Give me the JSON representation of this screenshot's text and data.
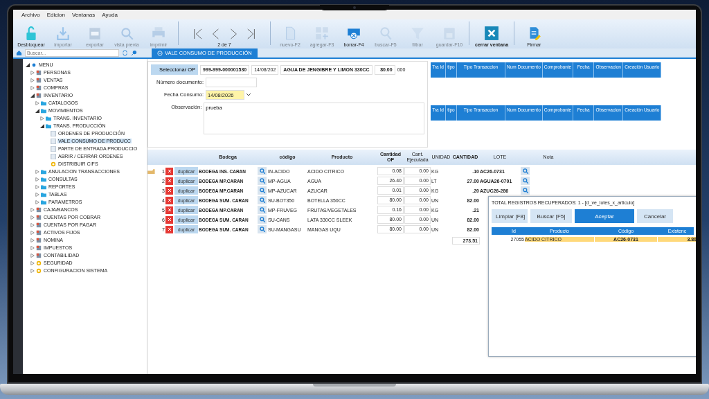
{
  "menu_bar": [
    "Archivo",
    "Edicion",
    "Ventanas",
    "Ayuda"
  ],
  "toolbar": [
    {
      "kind": "unlock",
      "label": "Desbloquear",
      "disabled": false
    },
    {
      "kind": "import",
      "label": "importar",
      "disabled": true
    },
    {
      "kind": "export",
      "label": "exportar",
      "disabled": true
    },
    {
      "kind": "preview",
      "label": "vista previa",
      "disabled": true
    },
    {
      "kind": "print",
      "label": "imprimir",
      "disabled": true
    },
    {
      "kind": "nav",
      "label": "2 de 7",
      "disabled": false
    },
    {
      "kind": "new",
      "label": "nuevo-F2",
      "disabled": true
    },
    {
      "kind": "add",
      "label": "agregar-F3",
      "disabled": true
    },
    {
      "kind": "delete",
      "label": "borrar-F4",
      "disabled": false
    },
    {
      "kind": "search",
      "label": "buscar-F5",
      "disabled": true
    },
    {
      "kind": "filter",
      "label": "filtrar",
      "disabled": true
    },
    {
      "kind": "save",
      "label": "guardar-F10",
      "disabled": true
    },
    {
      "kind": "close",
      "label": "cerrar ventana",
      "disabled": false
    },
    {
      "kind": "sign",
      "label": "Firmar",
      "disabled": false
    }
  ],
  "sidebar": {
    "search": {
      "placeholder": "Buscar..."
    },
    "tree": [
      {
        "label": "MENU",
        "kind": "root",
        "expanded": true,
        "selected": false,
        "children": [
          {
            "label": "PERSONAS",
            "kind": "module",
            "expanded": false,
            "selected": false
          },
          {
            "label": "VENTAS",
            "kind": "module",
            "expanded": false,
            "selected": false
          },
          {
            "label": "COMPRAS",
            "kind": "module",
            "expanded": false,
            "selected": false
          },
          {
            "label": "INVENTARIO",
            "kind": "module",
            "expanded": true,
            "selected": false,
            "children": [
              {
                "label": "CATALOGOS",
                "kind": "folder",
                "expanded": false,
                "selected": false
              },
              {
                "label": "MOVIMIENTOS",
                "kind": "folder",
                "expanded": true,
                "selected": false,
                "children": [
                  {
                    "label": "TRANS. INVENTARIO",
                    "kind": "folder",
                    "expanded": false,
                    "selected": false
                  },
                  {
                    "label": "TRANS. PRODUCCIÓN",
                    "kind": "folder",
                    "expanded": true,
                    "selected": false,
                    "children": [
                      {
                        "label": "ORDENES DE PRODUCCIÓN",
                        "kind": "document",
                        "selected": false
                      },
                      {
                        "label": "VALE CONSUMO DE PRODUCC",
                        "kind": "document",
                        "selected": true
                      },
                      {
                        "label": "PARTE DE ENTRADA PRODUCCIO",
                        "kind": "document",
                        "selected": false
                      },
                      {
                        "label": "ABRIR / CERRAR ORDENES",
                        "kind": "document",
                        "selected": false
                      },
                      {
                        "label": "DISTRIBUIR CIFS",
                        "kind": "process",
                        "selected": false
                      }
                    ]
                  }
                ]
              },
              {
                "label": "ANULACION TRANSACCIONES",
                "kind": "folder",
                "expanded": false,
                "selected": false
              },
              {
                "label": "CONSULTAS",
                "kind": "folder",
                "expanded": false,
                "selected": false
              },
              {
                "label": "REPORTES",
                "kind": "folder",
                "expanded": false,
                "selected": false
              },
              {
                "label": "TABLAS",
                "kind": "folder",
                "expanded": false,
                "selected": false
              },
              {
                "label": "PARAMETROS",
                "kind": "folder",
                "expanded": false,
                "selected": false
              }
            ]
          },
          {
            "label": "CAJA/BANCOS",
            "kind": "module",
            "expanded": false,
            "selected": false
          },
          {
            "label": "CUENTAS POR COBRAR",
            "kind": "module",
            "expanded": false,
            "selected": false
          },
          {
            "label": "CUENTAS POR PAGAR",
            "kind": "module",
            "expanded": false,
            "selected": false
          },
          {
            "label": "ACTIVOS FIJOS",
            "kind": "module",
            "expanded": false,
            "selected": false
          },
          {
            "label": "NOMINA",
            "kind": "module",
            "expanded": false,
            "selected": false
          },
          {
            "label": "IMPUESTOS",
            "kind": "module",
            "expanded": false,
            "selected": false
          },
          {
            "label": "CONTABILIDAD",
            "kind": "module",
            "expanded": false,
            "selected": false
          },
          {
            "label": "SEGURIDAD",
            "kind": "process",
            "expanded": false,
            "selected": false
          },
          {
            "label": "CONFIGURACION SISTEMA",
            "kind": "process",
            "expanded": false,
            "selected": false
          }
        ]
      }
    ]
  },
  "tabs": [
    {
      "label": "VALE CONSUMO DE PRODUCCIÓN",
      "selected": true
    }
  ],
  "form": {
    "select_button": "Seleccionar OP",
    "order": {
      "number": "999-999-000001530",
      "date": "14/08/202",
      "product": "AGUA DE JENGIBRE Y LIMON 330CC",
      "quantity": "80.00",
      "unit": "000"
    },
    "fields": [
      {
        "label": "Número documento:",
        "kind": "text"
      },
      {
        "label": "Fecha Consumo:",
        "value": "14/08/2026",
        "kind": "date"
      },
      {
        "label": "Observación:",
        "value": "prueba",
        "kind": "memo"
      }
    ]
  },
  "grids": [
    {
      "columns": [
        "Tra Id",
        "tipo",
        "Tipo Transaccion",
        "Num Documento",
        "Comprobante",
        "Fecha",
        "Observacion",
        "Creación Usuario"
      ]
    },
    {
      "columns": [
        "Tra Id",
        "tipo",
        "Tipo Transaccion",
        "Num Documento",
        "Comprobante",
        "Fecha",
        "Observacion",
        "Creación Usuario"
      ]
    }
  ],
  "detail": {
    "columns": [
      "Bodega",
      "código",
      "Producto",
      "Cantidad OP",
      "Cant. Ejecutada",
      "UNIDAD",
      "CANTIDAD",
      "LOTE",
      "Nota"
    ],
    "rows": [
      {
        "num": "1",
        "current": true,
        "action": "duplicar",
        "bodega": "BODEGA INS. CARAN",
        "codigo": "IN-ACIDO",
        "producto": "ACIDO CITRICO",
        "cantidad_op": "0.08",
        "ejecutada": "0.00",
        "unidad": "KG",
        "cantidad": ".10",
        "lote": "AC26-0731"
      },
      {
        "num": "2",
        "current": false,
        "action": "duplicar",
        "bodega": "BODEGA MP.CARAN",
        "codigo": "MP-AGUA",
        "producto": "AGUA",
        "cantidad_op": "26.40",
        "ejecutada": "0.00",
        "unidad": "LT",
        "cantidad": "27.00",
        "lote": "AGUA26-0701"
      },
      {
        "num": "3",
        "current": false,
        "action": "duplicar",
        "bodega": "BODEGA MP.CARAN",
        "codigo": "MP-AZUCAR",
        "producto": "AZUCAR",
        "cantidad_op": "0.01",
        "ejecutada": "0.00",
        "unidad": "KG",
        "cantidad": ".20",
        "lote": "AZUC26-286"
      },
      {
        "num": "4",
        "current": false,
        "action": "duplicar",
        "bodega": "BODEGA SUM. CARAN",
        "codigo": "SU-BOT350",
        "producto": "BOTELLA 350CC",
        "cantidad_op": "80.00",
        "ejecutada": "0.00",
        "unidad": "UN",
        "cantidad": "82.00"
      },
      {
        "num": "5",
        "current": false,
        "action": "duplicar",
        "bodega": "BODEGA MP.CARAN",
        "codigo": "MP-FRUVEG",
        "producto": "FRUTAS/VEGETALES",
        "cantidad_op": "0.16",
        "ejecutada": "0.00",
        "unidad": "KG",
        "cantidad": ".21"
      },
      {
        "num": "6",
        "current": false,
        "action": "duplicar",
        "bodega": "BODEGA SUM. CARAN",
        "codigo": "SU-CANS",
        "producto": "LATA 330CC SLEEK",
        "cantidad_op": "80.00",
        "ejecutada": "0.00",
        "unidad": "UN",
        "cantidad": "82.00"
      },
      {
        "num": "7",
        "current": false,
        "action": "duplicar",
        "bodega": "BODEGA SUM. CARAN",
        "codigo": "SU-MANGASU",
        "producto": "MANGAS UQU",
        "cantidad_op": "80.00",
        "ejecutada": "0.00",
        "unidad": "UN",
        "cantidad": "82.00"
      }
    ],
    "total": "273.51"
  },
  "popup": {
    "title": "TOTAL REGISTROS RECUPERADOS: 1  -  [d_ve_lotes_x_articulo]",
    "buttons": [
      {
        "label": "Limpiar [F8]",
        "kind": "plain"
      },
      {
        "label": "Buscar [F5]",
        "kind": "plain"
      },
      {
        "label": "Aceptar",
        "kind": "primary"
      },
      {
        "label": "Cancelar",
        "kind": "plain"
      }
    ],
    "columns": [
      "Id",
      "Producto",
      "Código",
      "Existenc"
    ],
    "rows": [
      {
        "id": "27055",
        "producto": "ACIDO CITRICO",
        "codigo": "AC26-0731",
        "existencia": "3.80",
        "selected": true
      }
    ]
  }
}
